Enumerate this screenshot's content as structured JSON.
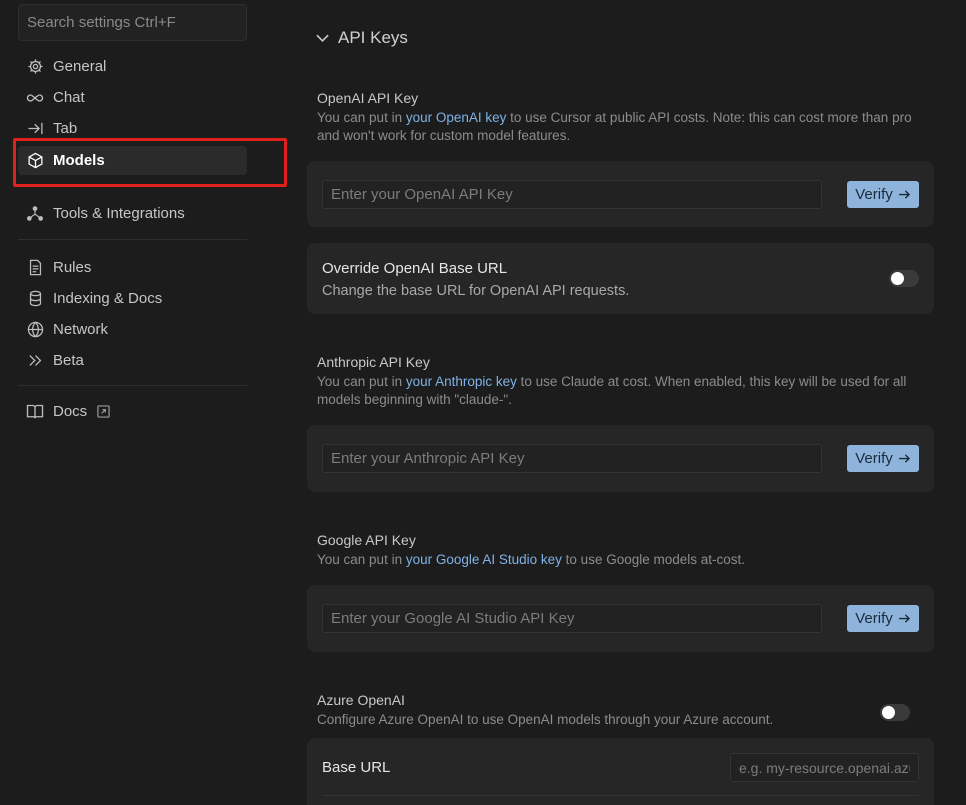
{
  "sidebar": {
    "search_placeholder": "Search settings Ctrl+F",
    "items": [
      {
        "label": "General",
        "icon": "gear-icon"
      },
      {
        "label": "Chat",
        "icon": "infinity-icon"
      },
      {
        "label": "Tab",
        "icon": "arrow-to-bar-icon"
      },
      {
        "label": "Models",
        "icon": "cube-icon",
        "active": true
      },
      {
        "label": "Tools & Integrations",
        "icon": "nodes-icon"
      },
      {
        "label": "Rules",
        "icon": "document-icon"
      },
      {
        "label": "Indexing & Docs",
        "icon": "database-icon"
      },
      {
        "label": "Network",
        "icon": "globe-icon"
      },
      {
        "label": "Beta",
        "icon": "double-chevron-icon"
      },
      {
        "label": "Docs",
        "icon": "book-icon"
      }
    ]
  },
  "main": {
    "section_title": "API Keys",
    "openai": {
      "title": "OpenAI API Key",
      "desc_before": "You can put in ",
      "desc_link": "your OpenAI key",
      "desc_after": " to use Cursor at public API costs. Note: this can cost more than pro and won't work for custom model features.",
      "placeholder": "Enter your OpenAI API Key",
      "verify_label": "Verify"
    },
    "override": {
      "title": "Override OpenAI Base URL",
      "subtitle": "Change the base URL for OpenAI API requests."
    },
    "anthropic": {
      "title": "Anthropic API Key",
      "desc_before": "You can put in ",
      "desc_link": "your Anthropic key",
      "desc_after": " to use Claude at cost. When enabled, this key will be used for all models beginning with \"claude-\".",
      "placeholder": "Enter your Anthropic API Key",
      "verify_label": "Verify"
    },
    "google": {
      "title": "Google API Key",
      "desc_before": "You can put in ",
      "desc_link": "your Google AI Studio key",
      "desc_after": " to use Google models at-cost.",
      "placeholder": "Enter your Google AI Studio API Key",
      "verify_label": "Verify"
    },
    "azure": {
      "title": "Azure OpenAI",
      "desc": "Configure Azure OpenAI to use OpenAI models through your Azure account.",
      "base_url_label": "Base URL",
      "base_url_placeholder": "e.g. my-resource.openai.azure.com"
    }
  },
  "colors": {
    "background": "#1c1c1c",
    "card": "#262626",
    "accent": "#8eb4dc",
    "link": "#7fb2e6",
    "highlight": "#e0201c"
  }
}
